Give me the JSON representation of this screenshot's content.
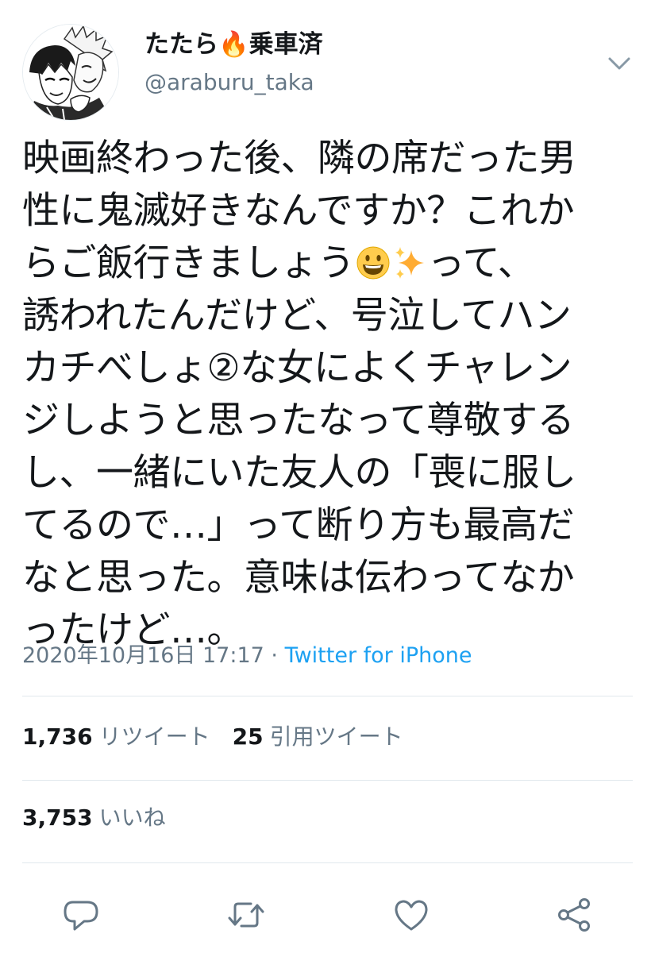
{
  "tweet": {
    "display_name": "たたら🔥乗車済",
    "username": "@araburu_taka",
    "text_lines": [
      "映画終わった後、隣の席だった男",
      "性に鬼滅好きなんですか？これか",
      "らご飯行きましょう",
      "って、",
      "誘われたんだけど、号泣してハン",
      "カチべしょ②な女によくチャレン",
      "ジしようと思ったなって尊敬する",
      "し、一緒にいた友人の「喪に服し",
      "てるので…」って断り方も最高だ",
      "なと思った。意味は伝わってなか",
      "ったけど…。"
    ],
    "emoji_icons": [
      "grinning-face-icon",
      "sparkles-icon"
    ],
    "timestamp": "2020年10月16日 17:17",
    "separator": " · ",
    "source": "Twitter for iPhone"
  },
  "stats": {
    "retweets_count": "1,736",
    "retweets_label": "リツイート",
    "quotes_count": "25",
    "quotes_label": "引用ツイート",
    "likes_count": "3,753",
    "likes_label": "いいね"
  },
  "icons": {
    "caret": "chevron-down-icon",
    "reply": "reply-icon",
    "retweet": "retweet-icon",
    "like": "heart-icon",
    "share": "share-icon"
  },
  "colors": {
    "text": "#14171a",
    "secondary": "#657786",
    "link": "#1da1f2",
    "icon": "#657786",
    "divider": "#e1e8ed"
  }
}
